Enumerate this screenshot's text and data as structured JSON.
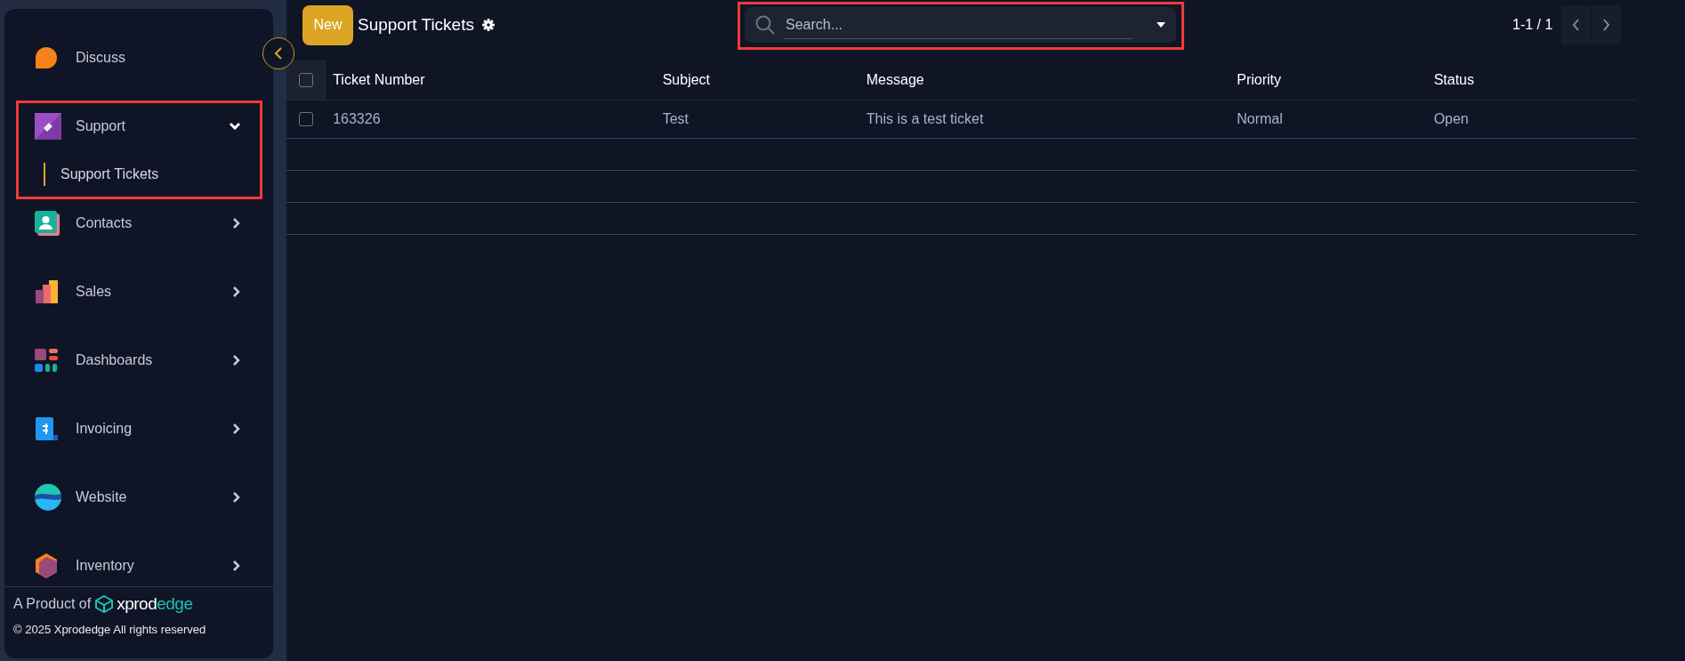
{
  "sidebar": {
    "items": [
      {
        "label": "Discuss",
        "has_children": false
      },
      {
        "label": "Support",
        "expanded": true,
        "has_children": true,
        "children": [
          {
            "label": "Support Tickets",
            "selected": true
          }
        ]
      },
      {
        "label": "Contacts",
        "expanded": false,
        "has_children": true
      },
      {
        "label": "Sales",
        "expanded": false,
        "has_children": true
      },
      {
        "label": "Dashboards",
        "expanded": false,
        "has_children": true
      },
      {
        "label": "Invoicing",
        "expanded": false,
        "has_children": true
      },
      {
        "label": "Website",
        "expanded": false,
        "has_children": true
      },
      {
        "label": "Inventory",
        "expanded": false,
        "has_children": true
      }
    ],
    "footer": {
      "product_prefix": "A Product of",
      "brand_main": "xprod",
      "brand_accent": "edge",
      "copyright": "© 2025 Xprodedge All rights reserved"
    }
  },
  "header": {
    "new_button": "New",
    "title": "Support Tickets",
    "search": {
      "placeholder": "Search..."
    },
    "pager": "1-1 / 1"
  },
  "table": {
    "columns": [
      "Ticket Number",
      "Subject",
      "Message",
      "Priority",
      "Status"
    ],
    "all_selected": false,
    "rows": [
      {
        "checked": false,
        "cells": [
          "163326",
          "Test",
          "This is a test ticket",
          "Normal",
          "Open"
        ]
      }
    ]
  }
}
